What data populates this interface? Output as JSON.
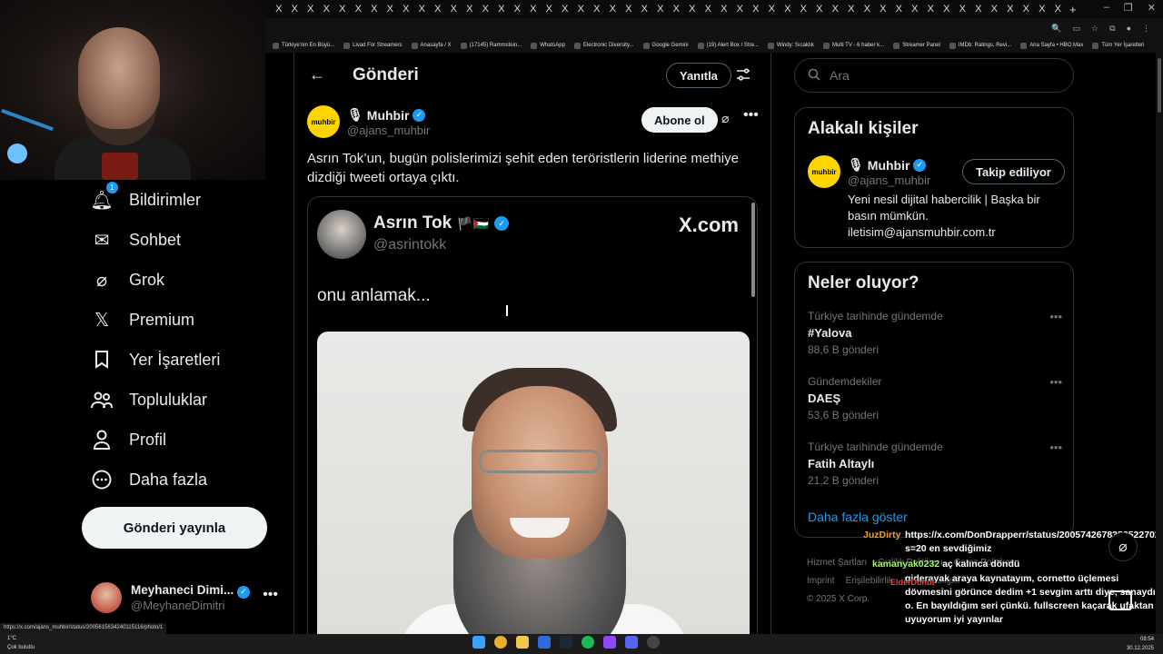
{
  "browser": {
    "tab_glyph": "X",
    "bookmarks": [
      "Türkiye'nin En Büyü...",
      "Livad For Streamers",
      "Anasayfa / X",
      "(17145) Rammstein...",
      "WhatsApp",
      "Electronic Diversity...",
      "Google Gemini",
      "(19) Alert Box / Stre...",
      "Windy: Sıcaklık",
      "Multi TV - 6 haber k...",
      "Streamer Panel",
      "IMDb: Ratings, Revi...",
      "Ana Sayfa • HBO Max",
      "Tüm Yer İşaretleri"
    ],
    "status_url": "https://x.com/ajans_muhbir/status/2005615634240115116/photo/1"
  },
  "nav": {
    "items": [
      {
        "label": "Bildirimler",
        "icon": "bell-icon",
        "badge": "1"
      },
      {
        "label": "Sohbet",
        "icon": "mail-icon"
      },
      {
        "label": "Grok",
        "icon": "grok-icon"
      },
      {
        "label": "Premium",
        "icon": "x-logo-icon"
      },
      {
        "label": "Yer İşaretleri",
        "icon": "bookmark-icon"
      },
      {
        "label": "Topluluklar",
        "icon": "communities-icon"
      },
      {
        "label": "Profil",
        "icon": "person-icon"
      },
      {
        "label": "Daha fazla",
        "icon": "more-circle-icon"
      }
    ],
    "post_button": "Gönderi yayınla",
    "account": {
      "name": "Meyhaneci Dimi...",
      "handle": "@MeyhaneDimitri",
      "more": "•••"
    }
  },
  "main": {
    "title": "Gönderi",
    "back": "←",
    "reply_button": "Yanıtla",
    "filter": "⚙",
    "author": {
      "name": "Muhbir",
      "handle": "@ajans_muhbir",
      "avatar_text": "muhbir",
      "mic": "🎙"
    },
    "subscribe_button": "Abone ol",
    "more": "•••",
    "text": "Asrın Tok’un, bugün polislerimizi şehit eden teröristlerin liderine methiye dizdiği tweeti ortaya çıktı.",
    "embed": {
      "name": "Asrın Tok",
      "flags": "🏴🇵🇸",
      "handle": "@asrintokk",
      "site": "X.com",
      "text": "onu anlamak..."
    }
  },
  "sidebar": {
    "search_placeholder": "Ara",
    "related_title": "Alakalı kişiler",
    "related": {
      "name": "Muhbir",
      "handle": "@ajans_muhbir",
      "avatar_text": "muhbir",
      "follow_button": "Takip ediliyor",
      "bio": "Yeni nesil dijital habercilik | Başka bir basın mümkün. iletisim@ajansmuhbir.com.tr"
    },
    "trends_title": "Neler oluyor?",
    "trends": [
      {
        "category": "Türkiye tarihinde gündemde",
        "title": "#Yalova",
        "count": "88,6 B gönderi"
      },
      {
        "category": "Gündemdekiler",
        "title": "DAEŞ",
        "count": "53,6 B gönderi"
      },
      {
        "category": "Türkiye tarihinde gündemde",
        "title": "Fatih Altaylı",
        "count": "21,2 B gönderi"
      }
    ],
    "show_more": "Daha fazla göster",
    "footer": [
      "Hizmet Şartları",
      "Gizlilik Politikası",
      "Çerez Politikası",
      "Imprint",
      "Erişilebilirlik",
      "Reklam bilgisi",
      "© 2025 X Corp."
    ]
  },
  "chat": [
    {
      "user": "JuzDirty",
      "text": "https://x.com/DonDrapperr/status/2005742678353522702?s=20 en sevdiğimiz"
    },
    {
      "user": "kamanyak0232",
      "text": "aç kalınca döndü"
    },
    {
      "user": "ElderDonut",
      "text": "giderayak araya kaynatayım, cornetto üçlemesi dövmesini görünce dedim +1 sevgim arttı diye, sanaydı o. En bayıldığım seri çünkü. fullscreen kaçarak ufaktan uyuyorum iyi yayınlar"
    }
  ],
  "taskbar": {
    "weather_temp": "1°C",
    "weather_text": "Çok bulutlu",
    "time": "08:54",
    "date": "30.12.2025"
  },
  "colors": {
    "accent": "#1d9bf0",
    "brand_yellow": "#ffd500",
    "bg": "#000000",
    "border": "#2f3336",
    "muted": "#71767b"
  }
}
